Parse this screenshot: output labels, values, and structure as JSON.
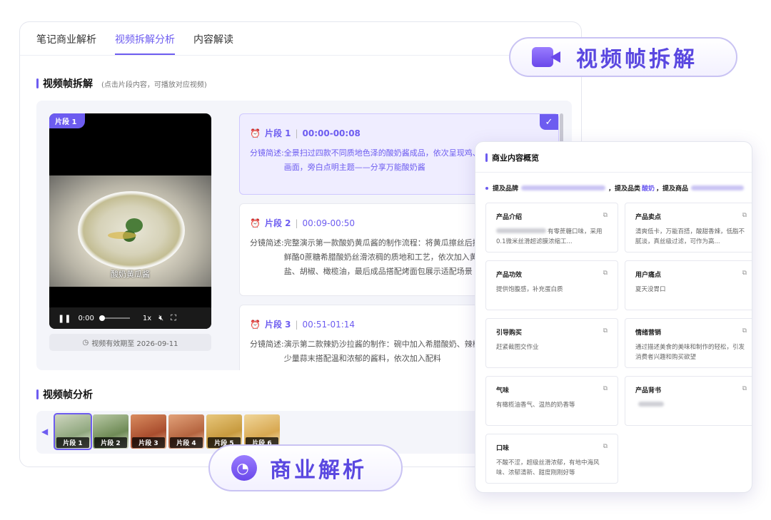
{
  "tabs": [
    "笔记商业解析",
    "视频拆解分析",
    "内容解读"
  ],
  "frames_section": {
    "title": "视频帧拆解",
    "hint": "(点击片段内容，可播放对应视频)"
  },
  "video": {
    "seg_tag": "片段 1",
    "caption": "酸奶黄瓜酱",
    "time": "0:00",
    "speed": "1x",
    "validity": "视频有效期至 2026-09-11"
  },
  "segments": [
    {
      "label": "片段 1",
      "range": "00:00-00:08",
      "key": "分镜简述:",
      "text": "全景扫过四款不同质地色泽的酸奶酱成品，依次呈现鸡、抹贝果、铺吐司的画面，旁白点明主题——分享万能酸奶酱"
    },
    {
      "label": "片段 2",
      "range": "00:09-00:50",
      "key": "分镜简述:",
      "text": "完整演示第一款酸奶黄瓜酱的制作流程：将黄瓜擦丝后挤出汁水，展示每日鲜酪0蔗糖希腊酸奶丝滑浓稠的质地和工艺，依次加入黄瓜丝、薄荷、蒜末、盐、胡椒、橄榄油，最后成品搭配烤面包展示适配场景"
    },
    {
      "label": "片段 3",
      "range": "00:51-01:14",
      "key": "分镜简述:",
      "text": "演示第二款辣奶沙拉酱的制作：碗中加入希腊酸奶、辣椒酱、蒜末等搅拌，少量蒜末搭配温和浓郁的酱料，依次加入配料"
    }
  ],
  "analysis_section": {
    "title": "视频帧分析"
  },
  "thumbs": [
    "片段 1",
    "片段 2",
    "片段 3",
    "片段 4",
    "片段 5",
    "片段 6"
  ],
  "badges": {
    "video": "视频帧拆解",
    "biz": "商业解析"
  },
  "biz": {
    "title": "商业内容概览",
    "mention": {
      "brand_label": "提及品牌",
      "category_label": "，提及品类",
      "category_value": "酸奶",
      "product_label": "，提及商品"
    },
    "cells": [
      {
        "title": "产品介绍",
        "text": "有零蔗糖口味，采用0.1微米丝滑超滤膜浓缩工..."
      },
      {
        "title": "产品卖点",
        "text": "清爽低卡，万能百搭，酸甜香辣，低脂不腻淡，真丝级过滤，可作为高..."
      },
      {
        "title": "产品功效",
        "text": "提供饱腹感，补充蛋白质"
      },
      {
        "title": "用户痛点",
        "text": "夏天没胃口"
      },
      {
        "title": "引导购买",
        "text": "赶紧截图交作业"
      },
      {
        "title": "情绪营销",
        "text": "通过描述美食的美味和制作的轻松，引发消费者兴趣和购买欲望"
      },
      {
        "title": "气味",
        "text": "有橄榄油香气、温热的奶香等"
      },
      {
        "title": "产品背书",
        "text": ""
      },
      {
        "title": "口味",
        "text": "不酸不涩，超级丝滑浓郁，有地中海风味、浓郁清新、甜度刚刚好等"
      }
    ]
  },
  "colors": {
    "accent": "#6d5cf0",
    "accent_light": "#efedff"
  },
  "icons": [
    "alarm-icon",
    "check-icon",
    "play-pause-icon",
    "mute-icon",
    "fullscreen-icon",
    "clock-icon",
    "chevron-left-icon",
    "camera-icon",
    "analytics-icon",
    "copy-icon"
  ]
}
